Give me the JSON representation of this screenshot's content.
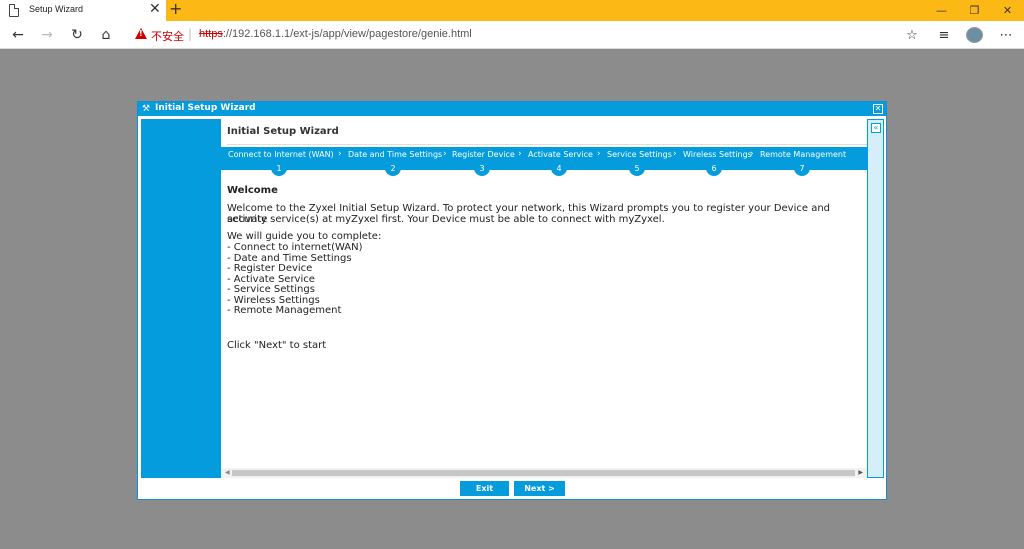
{
  "browser": {
    "tab_title": "Setup Wizard",
    "tab_close": "✕",
    "new_tab": "+",
    "insecure_label": "不安全",
    "url_scheme": "https",
    "url_rest": "://192.168.1.1/ext-js/app/view/pagestore/genie.html",
    "minimize": "—",
    "restore": "❐",
    "close": "✕"
  },
  "dialog": {
    "title": "Initial Setup Wizard",
    "close_glyph": "✕",
    "content_title": "Initial Setup Wizard",
    "collapse_glyph": "«",
    "steps": [
      {
        "label": "Connect to Internet (WAN)",
        "num": "1"
      },
      {
        "label": "Date and Time Settings",
        "num": "2"
      },
      {
        "label": "Register Device",
        "num": "3"
      },
      {
        "label": "Activate Service",
        "num": "4"
      },
      {
        "label": "Service Settings",
        "num": "5"
      },
      {
        "label": "Wireless Settings",
        "num": "6"
      },
      {
        "label": "Remote Management",
        "num": "7"
      }
    ],
    "welcome_heading": "Welcome",
    "intro_line1": "Welcome to the Zyxel Initial Setup Wizard. To protect your network, this Wizard prompts you to register your Device and activate",
    "intro_line2": "security service(s) at myZyxel first. Your Device must be able to connect with myZyxel.",
    "guide_heading": "We will guide you to complete:",
    "guide_items": [
      "- Connect to internet(WAN)",
      "- Date and Time Settings",
      "- Register Device",
      "- Activate Service",
      "- Service Settings",
      "- Wireless Settings",
      "- Remote Management"
    ],
    "start_hint": "Click \"Next\" to start",
    "exit_label": "Exit",
    "next_label": "Next >"
  }
}
